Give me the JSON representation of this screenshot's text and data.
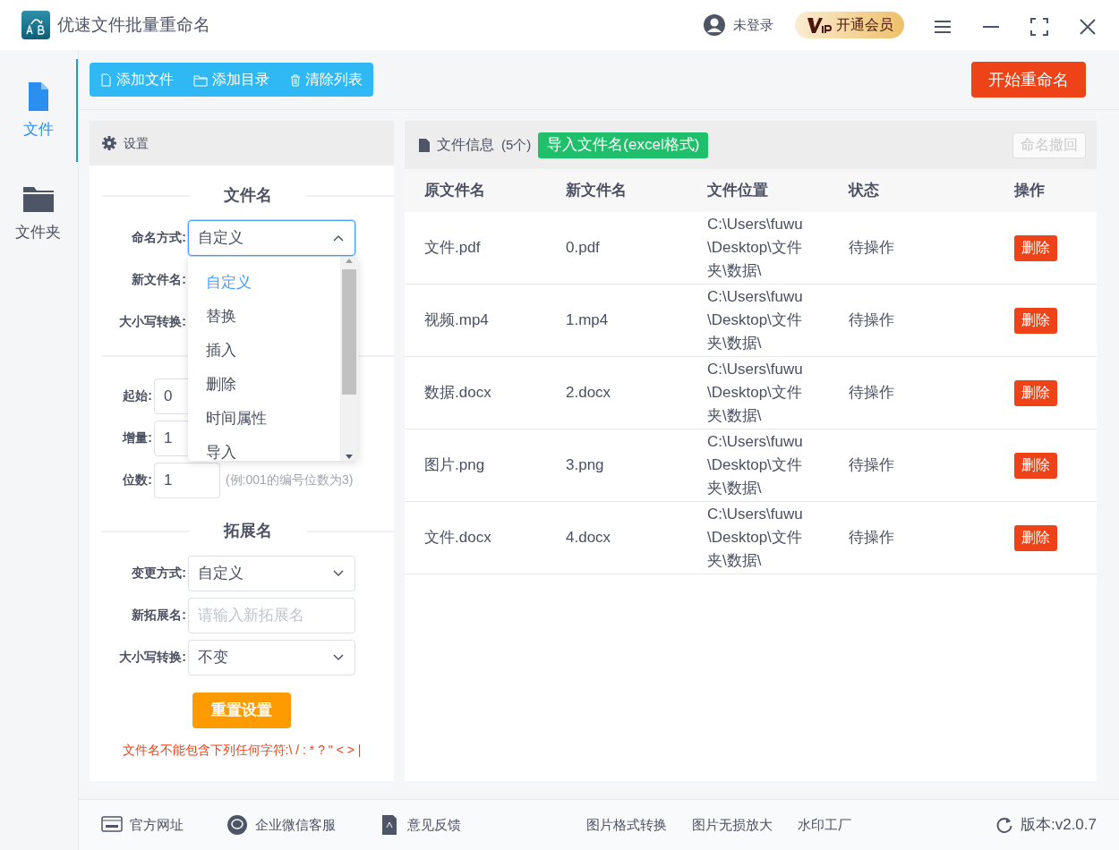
{
  "window": {
    "title": "优速文件批量重命名",
    "user": "未登录",
    "vip": "开通会员"
  },
  "sidebar": {
    "items": [
      {
        "label": "文件",
        "kind": "file",
        "selected": true
      },
      {
        "label": "文件夹",
        "kind": "folder",
        "selected": false
      }
    ]
  },
  "toolbar": {
    "buttons": [
      {
        "label": "添加文件",
        "kind": "file"
      },
      {
        "label": "添加目录",
        "kind": "folder"
      },
      {
        "label": "清除列表",
        "kind": "trash"
      }
    ],
    "start": "开始重命名"
  },
  "settings": {
    "title": "设置",
    "filename": {
      "heading": "文件名",
      "mode_label": "命名方式:",
      "mode_value": "自定义",
      "new_name_label": "新文件名:",
      "case_label": "大小写转换:",
      "dropdown": {
        "expanded": true,
        "options": [
          {
            "label": "自定义",
            "selected": true
          },
          {
            "label": "替换",
            "selected": false
          },
          {
            "label": "插入",
            "selected": false
          },
          {
            "label": "删除",
            "selected": false
          },
          {
            "label": "时间属性",
            "selected": false
          },
          {
            "label": "导入",
            "selected": false
          }
        ]
      },
      "start_label": "起始:",
      "start_value": "0",
      "step_label": "增量:",
      "step_value": "1",
      "digits_label": "位数:",
      "digits_value": "1",
      "digits_hint": "(例:001的编号位数为3)"
    },
    "extension": {
      "heading": "拓展名",
      "mode_label": "变更方式:",
      "mode_value": "自定义",
      "new_ext_label": "新拓展名:",
      "new_ext_placeholder": "请输入新拓展名",
      "case_label": "大小写转换:",
      "case_value": "不变"
    },
    "reset": "重置设置",
    "warning": "文件名不能包含下列任何字符:\\ / : * ? \" < > |"
  },
  "files": {
    "title": "文件信息",
    "count": "(5个)",
    "import": "导入文件名(excel格式)",
    "undo": {
      "label": "命名撤回",
      "disabled": true
    },
    "columns": [
      "原文件名",
      "新文件名",
      "文件位置",
      "状态",
      "操作"
    ],
    "rows": [
      {
        "original": "文件.pdf",
        "new": "0.pdf",
        "location": "C:\\Users\\fuwu\\Desktop\\文件夹\\数据\\",
        "status": "待操作",
        "action": "删除"
      },
      {
        "original": "视频.mp4",
        "new": "1.mp4",
        "location": "C:\\Users\\fuwu\\Desktop\\文件夹\\数据\\",
        "status": "待操作",
        "action": "删除"
      },
      {
        "original": "数据.docx",
        "new": "2.docx",
        "location": "C:\\Users\\fuwu\\Desktop\\文件夹\\数据\\",
        "status": "待操作",
        "action": "删除"
      },
      {
        "original": "图片.png",
        "new": "3.png",
        "location": "C:\\Users\\fuwu\\Desktop\\文件夹\\数据\\",
        "status": "待操作",
        "action": "删除"
      },
      {
        "original": "文件.docx",
        "new": "4.docx",
        "location": "C:\\Users\\fuwu\\Desktop\\文件夹\\数据\\",
        "status": "待操作",
        "action": "删除"
      }
    ]
  },
  "footer": {
    "links": [
      {
        "label": "官方网址",
        "kind": "web"
      },
      {
        "label": "企业微信客服",
        "kind": "chat"
      },
      {
        "label": "意见反馈",
        "kind": "feedback"
      }
    ],
    "tools": [
      "图片格式转换",
      "图片无损放大",
      "水印工厂"
    ],
    "version": "版本:v2.0.7"
  }
}
